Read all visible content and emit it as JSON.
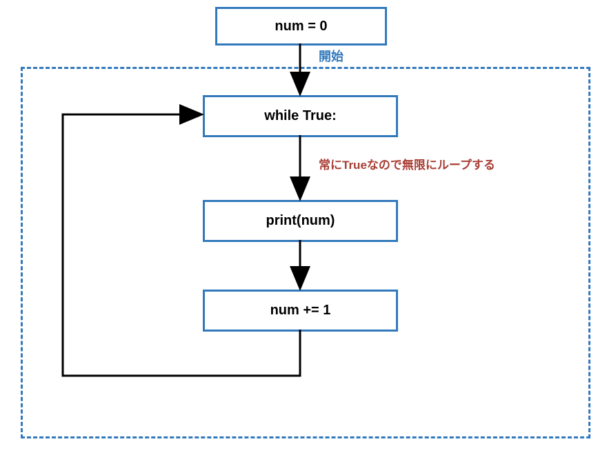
{
  "diagram": {
    "nodes": {
      "init": "num = 0",
      "while": "while True:",
      "print": "print(num)",
      "increment": "num += 1"
    },
    "labels": {
      "start": "開始",
      "loopNote": "常にTrueなので無限にループする"
    },
    "colors": {
      "boxBorder": "#3279bc",
      "arrow": "#000000",
      "labelBlue": "#3279bc",
      "labelRed": "#a83d34"
    }
  }
}
